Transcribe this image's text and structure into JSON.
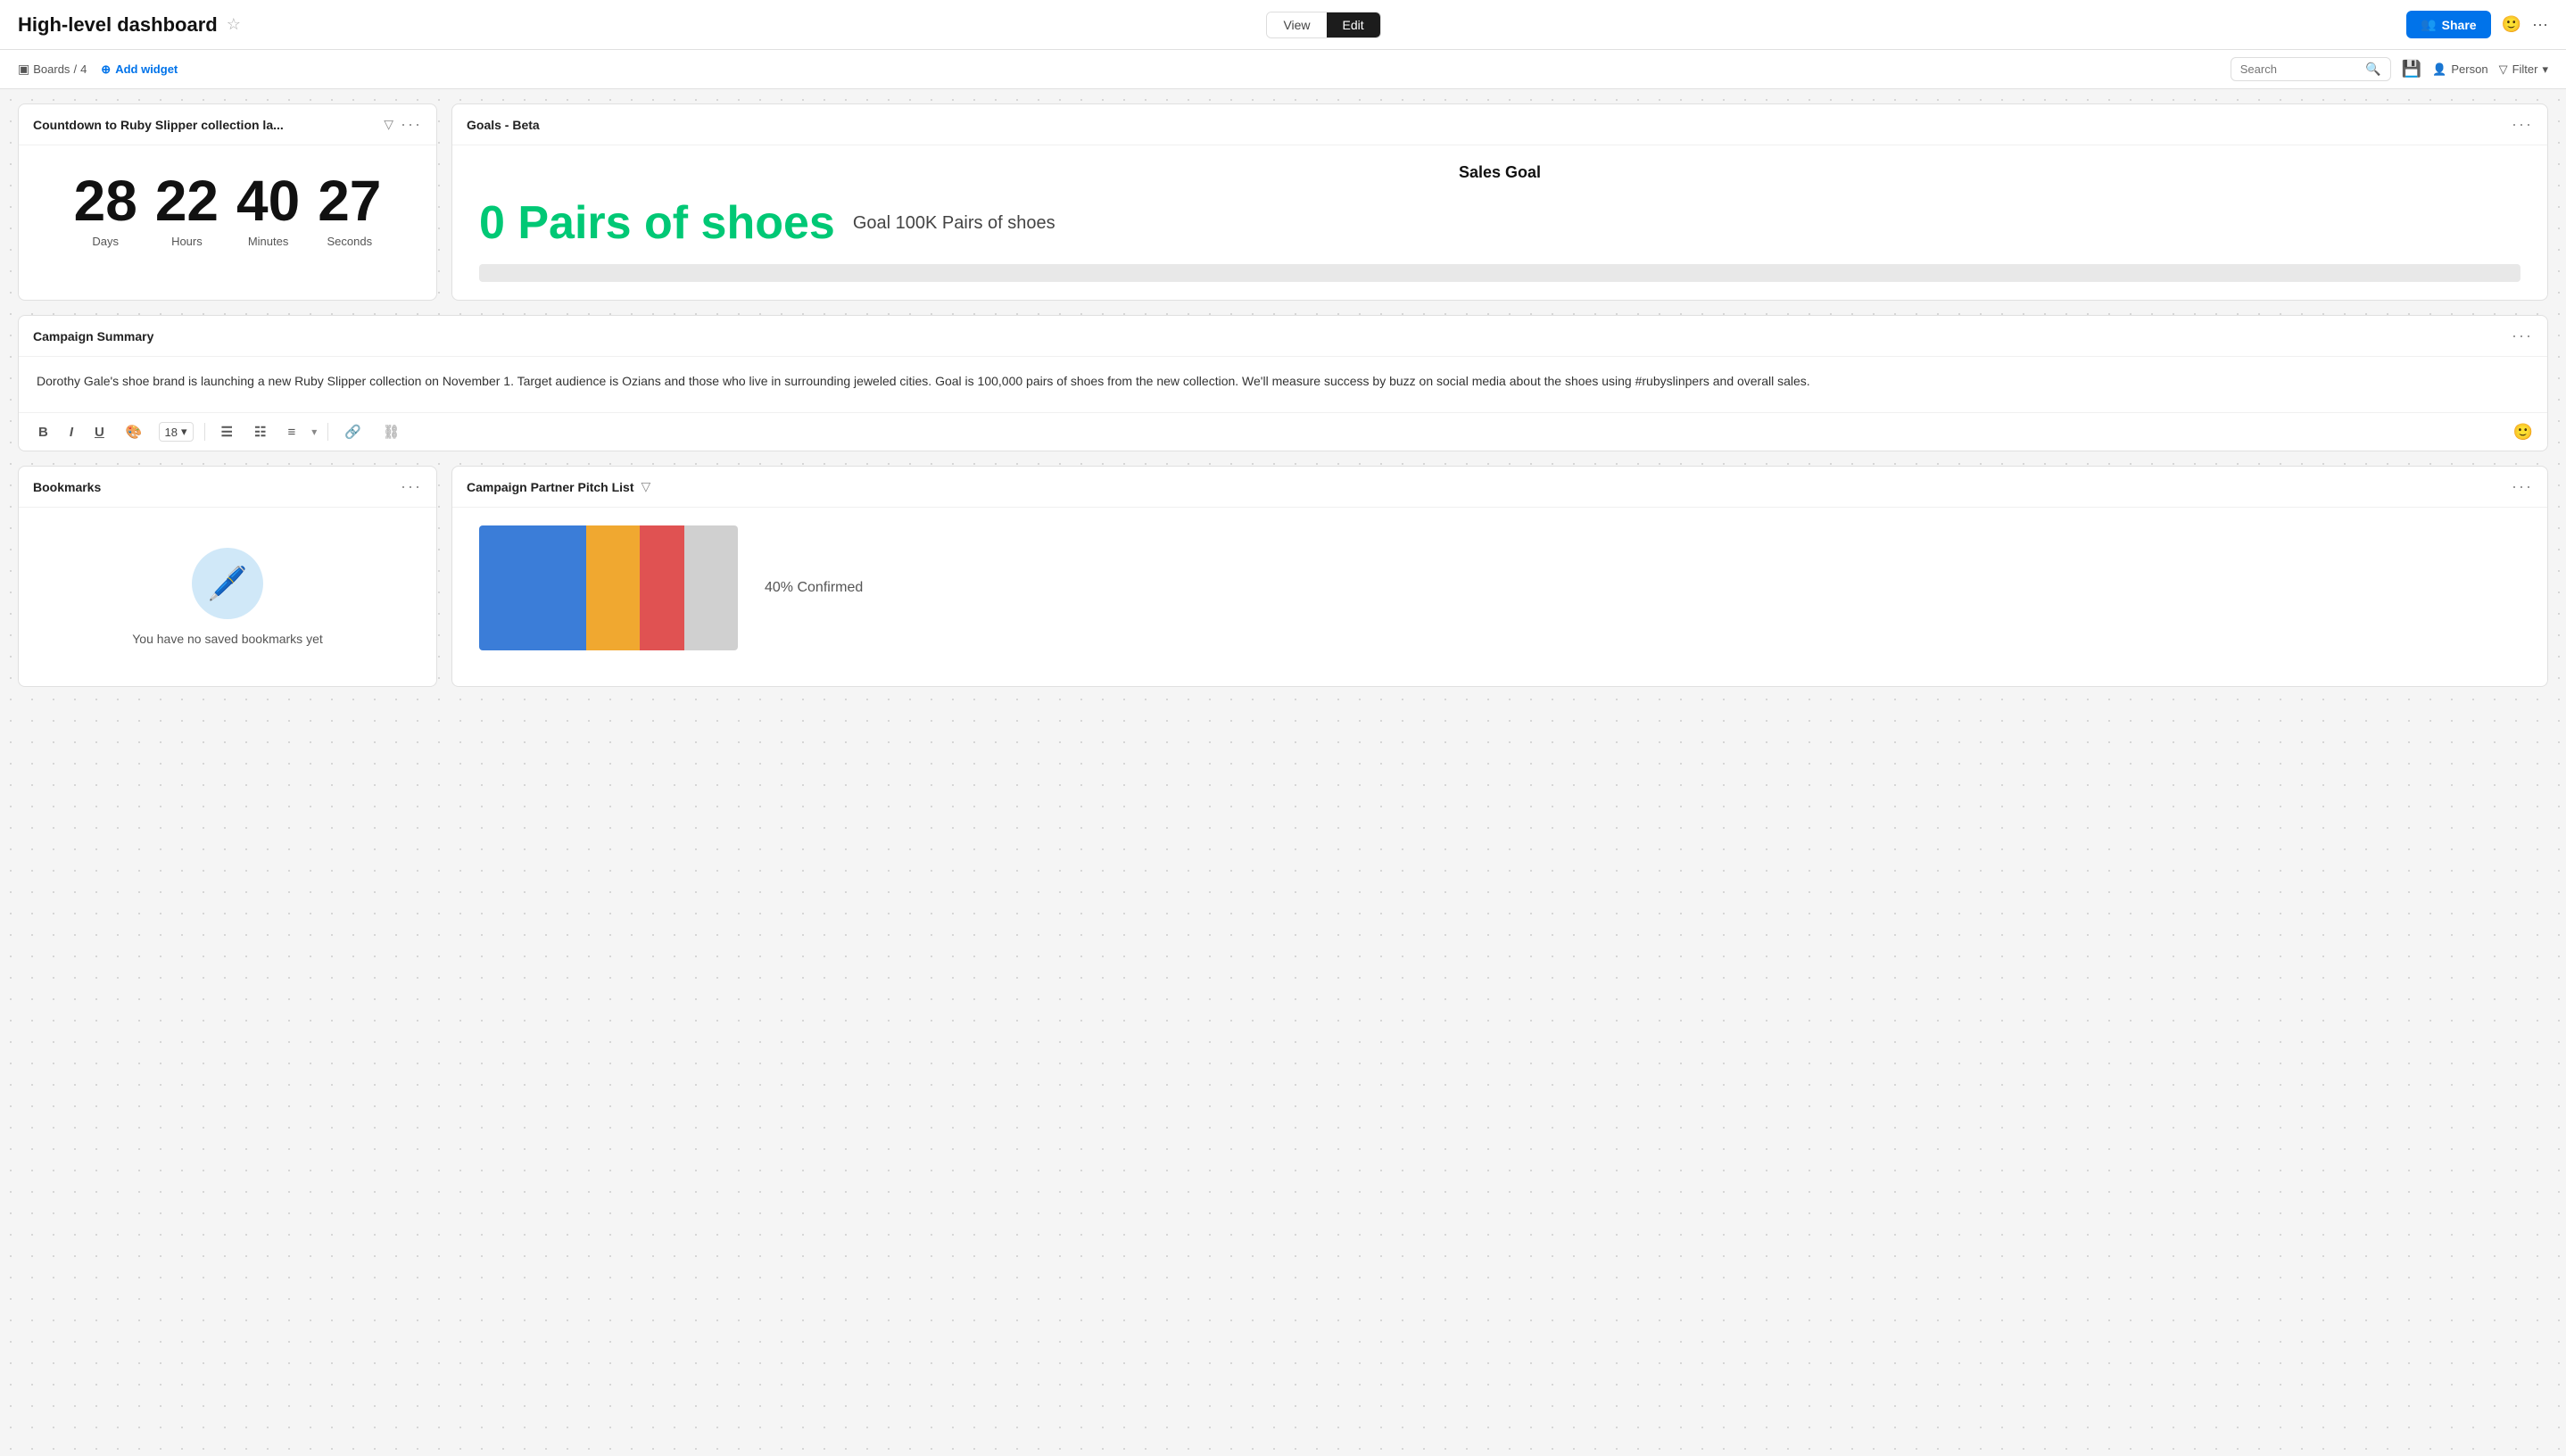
{
  "header": {
    "title": "High-level dashboard",
    "view_label": "View",
    "edit_label": "Edit",
    "share_label": "Share"
  },
  "subheader": {
    "breadcrumb_icon": "▣",
    "boards_label": "Boards",
    "breadcrumb_sep": "/",
    "breadcrumb_count": "4",
    "add_widget_label": "Add widget",
    "search_placeholder": "Search",
    "person_label": "Person",
    "filter_label": "Filter"
  },
  "countdown_widget": {
    "title": "Countdown to Ruby Slipper collection la...",
    "days_value": "28",
    "days_label": "Days",
    "hours_value": "22",
    "hours_label": "Hours",
    "minutes_value": "40",
    "minutes_label": "Minutes",
    "seconds_value": "27",
    "seconds_label": "Seconds"
  },
  "goals_widget": {
    "title": "Goals - Beta",
    "chart_title": "Sales Goal",
    "current_value": "0 Pairs of shoes",
    "target_label": "Goal 100K Pairs of shoes",
    "progress_pct": 0
  },
  "campaign_summary": {
    "title": "Campaign Summary",
    "text": "Dorothy Gale's shoe brand is launching a new Ruby Slipper collection on November 1. Target audience is Ozians and those who live in surrounding jeweled cities. Goal is 100,000 pairs of shoes from the new collection. We'll measure success by buzz on social media about the shoes using #rubyslinpers and overall sales.",
    "bold_label": "B",
    "italic_label": "I",
    "underline_label": "U",
    "font_size": "18",
    "list_unordered": "☰",
    "list_ordered": "☷",
    "align_label": "≡",
    "link_label": "🔗",
    "unlink_label": "⛓"
  },
  "bookmarks_widget": {
    "title": "Bookmarks",
    "empty_text": "You have no saved bookmarks yet"
  },
  "pitch_widget": {
    "title": "Campaign Partner Pitch List",
    "confirmed_text": "40% Confirmed",
    "bars": [
      {
        "color": "#3b7dd8",
        "width": 120
      },
      {
        "color": "#f0a830",
        "width": 60
      },
      {
        "color": "#e05252",
        "width": 50
      },
      {
        "color": "#d0d0d0",
        "width": 60
      }
    ]
  }
}
